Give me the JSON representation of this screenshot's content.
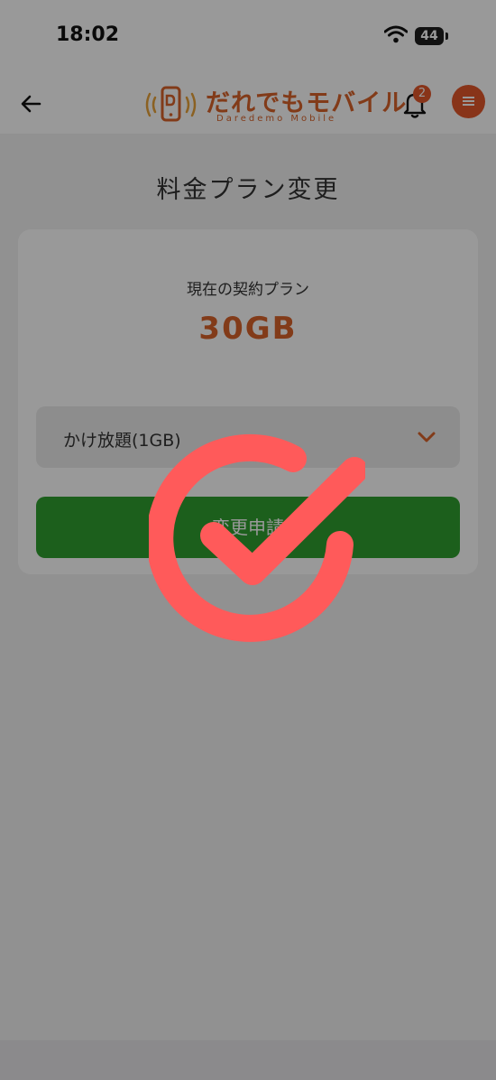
{
  "status_bar": {
    "time": "18:02",
    "battery": "44"
  },
  "header": {
    "logo_text": "だれでもモバイル",
    "logo_subtext": "Daredemo Mobile",
    "notification_count": "2",
    "brand_color": "#e3572b"
  },
  "page": {
    "title": "料金プラン変更"
  },
  "plan": {
    "current_label": "現在の契約プラン",
    "current_value": "30GB",
    "select_value": "かけ放題(1GB)",
    "submit_label": "変更申請"
  },
  "overlay": {
    "icon": "check-circle-icon",
    "color": "#ff5a5a"
  }
}
